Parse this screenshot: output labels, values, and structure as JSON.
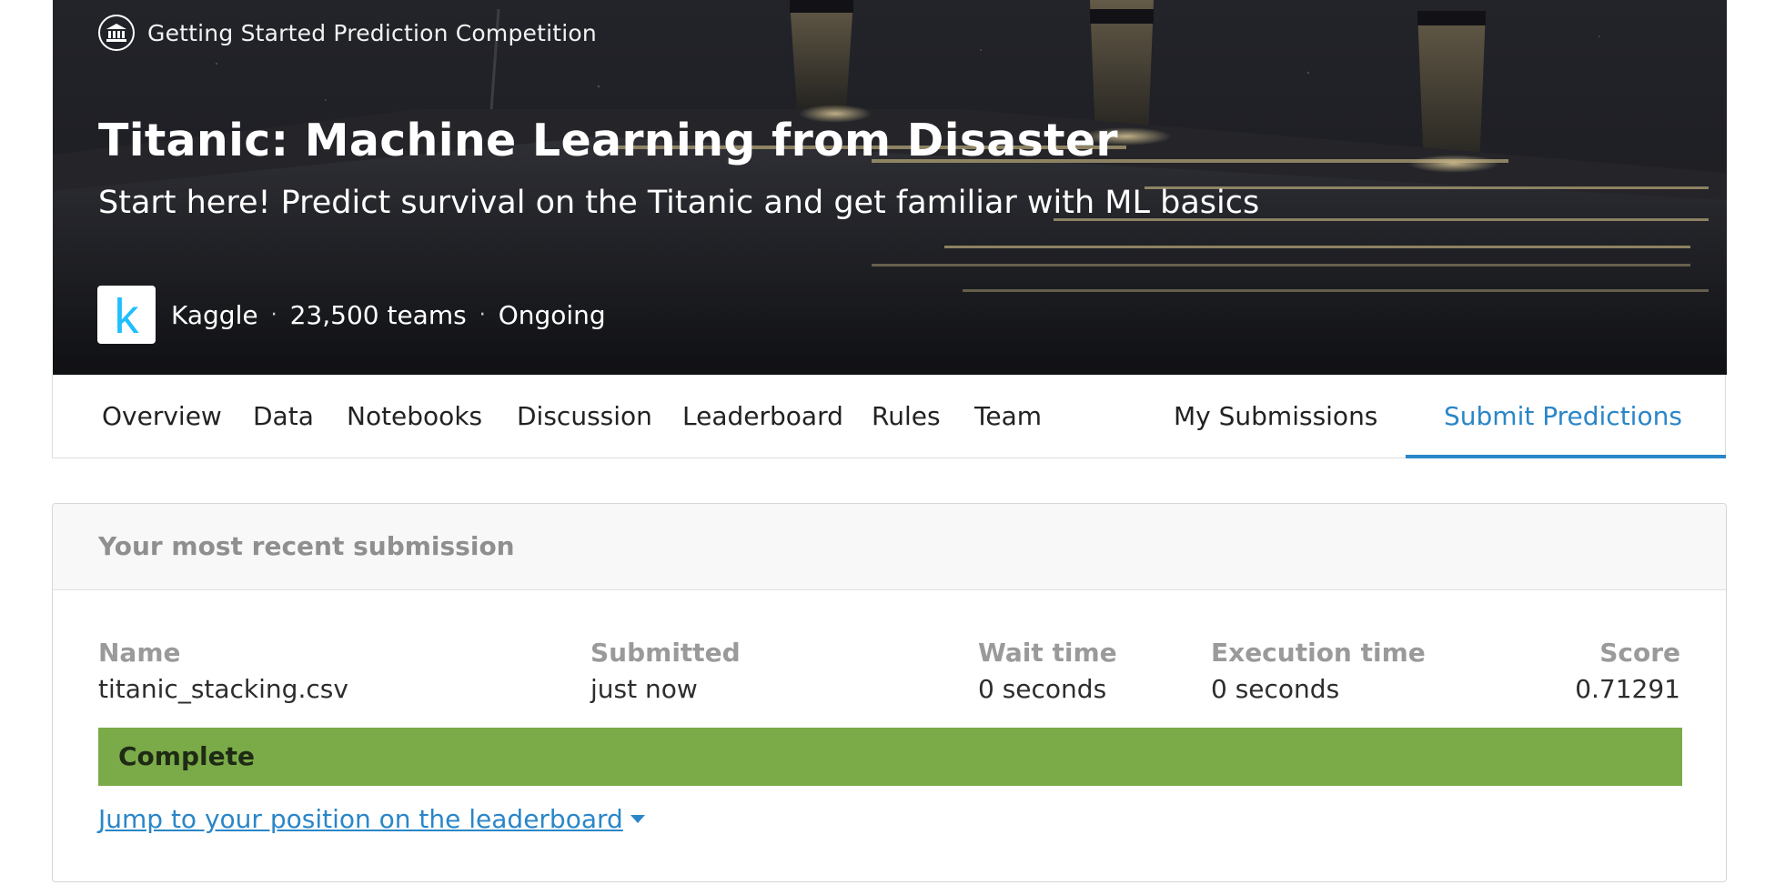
{
  "hero": {
    "eyebrow_icon": "bank-building-icon",
    "eyebrow": "Getting Started Prediction Competition",
    "title": "Titanic: Machine Learning from Disaster",
    "subtitle": "Start here! Predict survival on the Titanic and get familiar with ML basics",
    "logo_letter": "k",
    "host": "Kaggle",
    "teams": "23,500 teams",
    "status": "Ongoing",
    "separator": "·"
  },
  "tabs": [
    {
      "label": "Overview",
      "active": false
    },
    {
      "label": "Data",
      "active": false
    },
    {
      "label": "Notebooks",
      "active": false
    },
    {
      "label": "Discussion",
      "active": false
    },
    {
      "label": "Leaderboard",
      "active": false
    },
    {
      "label": "Rules",
      "active": false
    },
    {
      "label": "Team",
      "active": false
    },
    {
      "label": "My Submissions",
      "active": false
    },
    {
      "label": "Submit Predictions",
      "active": true
    }
  ],
  "submission": {
    "header": "Your most recent submission",
    "columns": {
      "name": {
        "label": "Name",
        "value": "titanic_stacking.csv"
      },
      "submitted": {
        "label": "Submitted",
        "value": "just now"
      },
      "wait_time": {
        "label": "Wait time",
        "value": "0 seconds"
      },
      "execution_time": {
        "label": "Execution time",
        "value": "0 seconds"
      },
      "score": {
        "label": "Score",
        "value": "0.71291"
      }
    },
    "status": "Complete",
    "leaderboard_link": "Jump to your position on the leaderboard"
  },
  "colors": {
    "accent": "#2a86c8",
    "status_complete": "#7aab48",
    "kaggle_blue": "#20beff"
  }
}
